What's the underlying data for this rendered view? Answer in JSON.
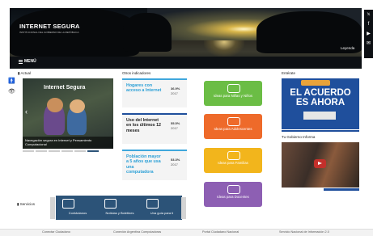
{
  "header": {
    "brand": "INTERNET SEGURA",
    "brand_sub": "INSTITUCIONAL DEL GOBIERNO DE LA REPÚBLICA",
    "menu_label": "MENÚ",
    "leyenda": "Leyenda"
  },
  "social": [
    "twitter-icon",
    "facebook-icon",
    "youtube-icon",
    "email-icon"
  ],
  "actual": {
    "title": "Actual",
    "slide_title": "Internet Segura",
    "slide_caption": "Navegación segura en Internet y Pensamiento Computacional"
  },
  "indicadores": {
    "title": "Otros indicadores",
    "items": [
      {
        "label": "Hogares con acceso a Internet",
        "pct": "36.9%",
        "year": "2017",
        "color": "#2a9fd6"
      },
      {
        "label": "Uso del Internet en los últimos 12 meses",
        "pct": "55.5%",
        "year": "2017",
        "color": "#222222"
      },
      {
        "label": "Población mayor a 5 años que usa una computadora",
        "pct": "53.3%",
        "year": "2017",
        "color": "#2a9fd6"
      }
    ]
  },
  "ideas": [
    {
      "label": "Ideas para Niñas y Niños",
      "color": "#6bbd45"
    },
    {
      "label": "Ideas para Adolescentes",
      "color": "#ee6a2a"
    },
    {
      "label": "Ideas para Familias",
      "color": "#f2b51c"
    },
    {
      "label": "Ideas para Docentes",
      "color": "#8d5fb3"
    }
  ],
  "enterate": {
    "title": "Entérate",
    "headline": "EL ACUERDO ES AHORA"
  },
  "gobierno": {
    "title": "Tu Gobierno Informa"
  },
  "servicios": {
    "title": "Servicios",
    "items": [
      {
        "label": "Contáctanos",
        "icon": "people-icon"
      },
      {
        "label": "Noticias y Boletines",
        "icon": "newspaper-icon"
      },
      {
        "label": "Una guía para ti",
        "icon": "book-icon"
      }
    ]
  },
  "footer": [
    "Conectar Ciudadano",
    "Conexión Argentina Computadoras",
    "Portal Ciudadano Nacional",
    "Servicio Nacional de Información 2.0"
  ]
}
